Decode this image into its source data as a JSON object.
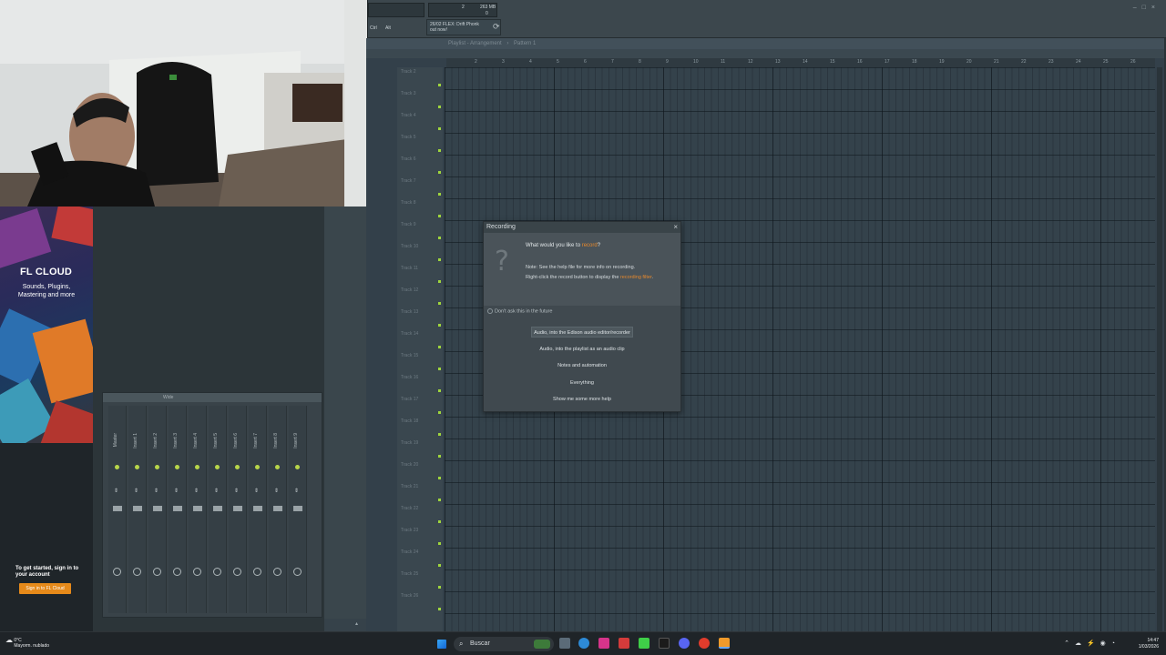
{
  "toolbar": {
    "counter_value": "2",
    "memory": "263 MB",
    "memory_sub": "0",
    "hint_line1": "26/02 FLEX: Drift Phonk",
    "hint_line2": "out now!",
    "label_ctrl": "Ctrl",
    "label_alt": "Alt"
  },
  "fl_cloud": {
    "title": "FL CLOUD",
    "subtitle": "Sounds, Plugins, Mastering and more",
    "signin_prompt": "To get started, sign in to your account",
    "signin_button": "Sign in to FL Cloud"
  },
  "mixer": {
    "title": "Wide",
    "tracks": [
      "Master",
      "Insert 1",
      "Insert 2",
      "Insert 3",
      "Insert 4",
      "Insert 5",
      "Insert 6",
      "Insert 7",
      "Insert 8",
      "Insert 9"
    ]
  },
  "playlist": {
    "title": "Playlist - Arrangement",
    "pattern": "Pattern 1",
    "ruler": [
      "2",
      "3",
      "4",
      "5",
      "6",
      "7",
      "8",
      "9",
      "10",
      "11",
      "12",
      "13",
      "14",
      "15",
      "16",
      "17",
      "18",
      "19",
      "20",
      "21",
      "22",
      "23",
      "24",
      "25",
      "26"
    ],
    "tracks": [
      "Track 2",
      "Track 3",
      "Track 4",
      "Track 5",
      "Track 6",
      "Track 7",
      "Track 8",
      "Track 9",
      "Track 10",
      "Track 11",
      "Track 12",
      "Track 13",
      "Track 14",
      "Track 15",
      "Track 16",
      "Track 17",
      "Track 18",
      "Track 19",
      "Track 20",
      "Track 21",
      "Track 22",
      "Track 23",
      "Track 24",
      "Track 25",
      "Track 26"
    ]
  },
  "dialog": {
    "title": "Recording",
    "close": "×",
    "question_prefix": "What would you like to ",
    "question_link": "record",
    "question_suffix": "?",
    "note_line1": "Note: See the help file for more info on recording.",
    "note_line2_prefix": "Right-click the record button to display the ",
    "note_line2_link": "recording filter",
    "note_line2_suffix": ".",
    "checkbox_label": "Don't ask this in the future",
    "options": [
      "Audio, into the Edison audio editor/recorder",
      "Audio, into the playlist as an audio clip",
      "Notes and automation",
      "Everything",
      "Show me some more help"
    ]
  },
  "taskbar": {
    "temperature": "0°C",
    "weather": "Mayorm. nublado",
    "search_placeholder": "Buscar",
    "time": "14:47",
    "date": "1/03/2026"
  }
}
